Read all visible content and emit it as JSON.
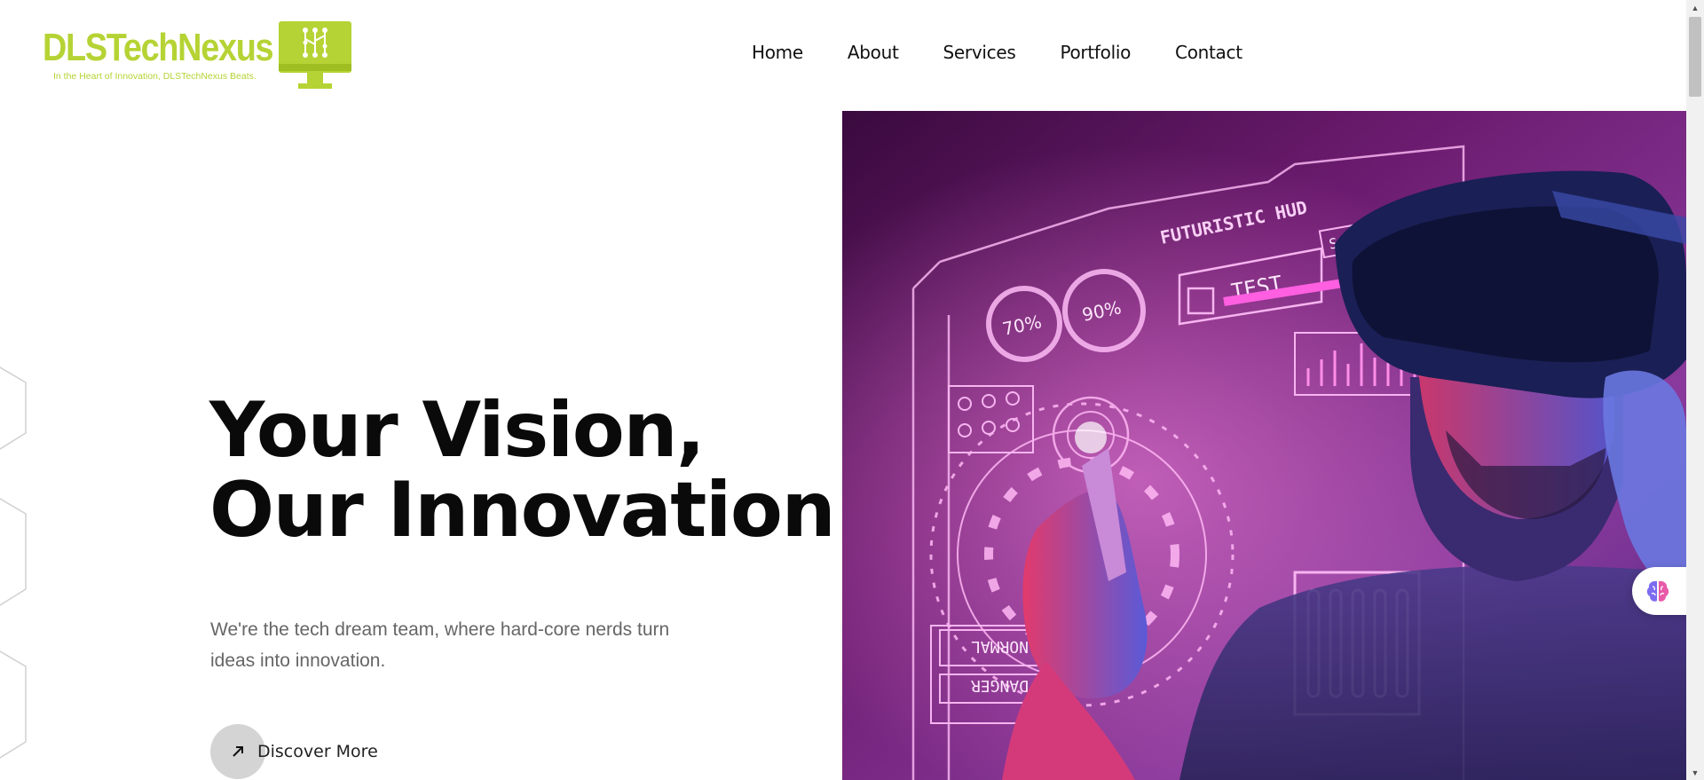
{
  "brand": {
    "name": "DLSTechNexus",
    "tagline": "In the Heart of Innovation, DLSTechNexus Beats.",
    "color": "#b5d334"
  },
  "nav": {
    "items": [
      {
        "label": "Home"
      },
      {
        "label": "About"
      },
      {
        "label": "Services"
      },
      {
        "label": "Portfolio"
      },
      {
        "label": "Contact"
      }
    ]
  },
  "hero": {
    "title_line1": "Your Vision,",
    "title_line2": "Our Innovation",
    "subtitle": "We're the tech dream team, where hard-core nerds turn ideas into innovation.",
    "cta_label": "Discover More",
    "cta_icon": "arrow-up-right-icon",
    "image": {
      "hud_title": "FUTURISTIC HUD",
      "hud_badge": "S-01",
      "hud_test": "TEST",
      "gauge1": "70%",
      "gauge2": "90%",
      "normal_label": "NORMAL",
      "danger_label": "DANGER"
    }
  },
  "widget": {
    "icon": "brain-icon"
  },
  "scrollbar": {
    "up_icon": "▲",
    "down_icon": "▼"
  }
}
